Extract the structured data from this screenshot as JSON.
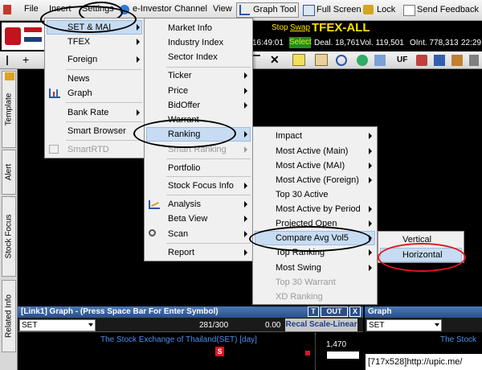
{
  "menubar": {
    "file": "File",
    "insert": "Insert",
    "settings": "Settings",
    "einvestor": "e-Investor Channel",
    "view": "View",
    "graph_tool": "Graph Tool",
    "full_screen": "Full Screen",
    "lock": "Lock",
    "send_feedback": "Send Feedback"
  },
  "header": {
    "stop": "Stop",
    "swap": "Swap",
    "select": "Select",
    "symbol": "TFEX-ALL",
    "time": "16:49:01",
    "deal": "Deal. 18,761",
    "vol": "Vol. 119,501",
    "oint": "OInt. 778,313",
    "time2": "22:29:"
  },
  "toolbar": {
    "uf": "UF"
  },
  "insert_menu": {
    "items": [
      "SET & MAI",
      "TFEX",
      "Foreign",
      "News",
      "Graph",
      "Bank Rate",
      "Smart Browser",
      "SmartRTD"
    ]
  },
  "set_mai_menu": {
    "items": [
      "Market Info",
      "Industry Index",
      "Sector Index",
      "Ticker",
      "Price",
      "BidOffer",
      "Warrant",
      "Ranking",
      "Smart Ranking",
      "Portfolio",
      "Stock Focus Info",
      "Analysis",
      "Beta View",
      "Scan",
      "Report"
    ]
  },
  "ranking_menu": {
    "items": [
      "Impact",
      "Most Active (Main)",
      "Most Active (MAI)",
      "Most Active (Foreign)",
      "Top 30 Active",
      "Most Active by Period",
      "Projected Open",
      "Compare Avg Vol5",
      "Top Ranking",
      "Most Swing",
      "Top 30 Warrant",
      "XD Ranking"
    ]
  },
  "compare_menu": {
    "items": [
      "Vertical",
      "Horizontal"
    ]
  },
  "side_tabs": [
    "Template",
    "Alert",
    "Stock Focus",
    "Related Info"
  ],
  "graph_panel": {
    "title": "[Link1] Graph  - (Press Space Bar For Enter Symbol)",
    "t_btn": "T",
    "out_btn": "OUT",
    "x_btn": "X",
    "symbol": "SET",
    "paging": "281/300",
    "value": "0.00",
    "scale_btn": "Recal Scale-Linear",
    "chart_caption": "The Stock Exchange of Thailand(SET) [day]",
    "price_label": "1,470",
    "s_marker": "S"
  },
  "graph_panel2": {
    "title": "Graph",
    "symbol": "SET",
    "caption": "The Stock"
  },
  "watermark": "[717x528]http://upic.me/",
  "colors": {
    "highlight": "#c7dcf2",
    "annotation_ellipse": "#000000",
    "annotation_red": "#e0141e",
    "symbol_yellow": "#ffe000"
  }
}
